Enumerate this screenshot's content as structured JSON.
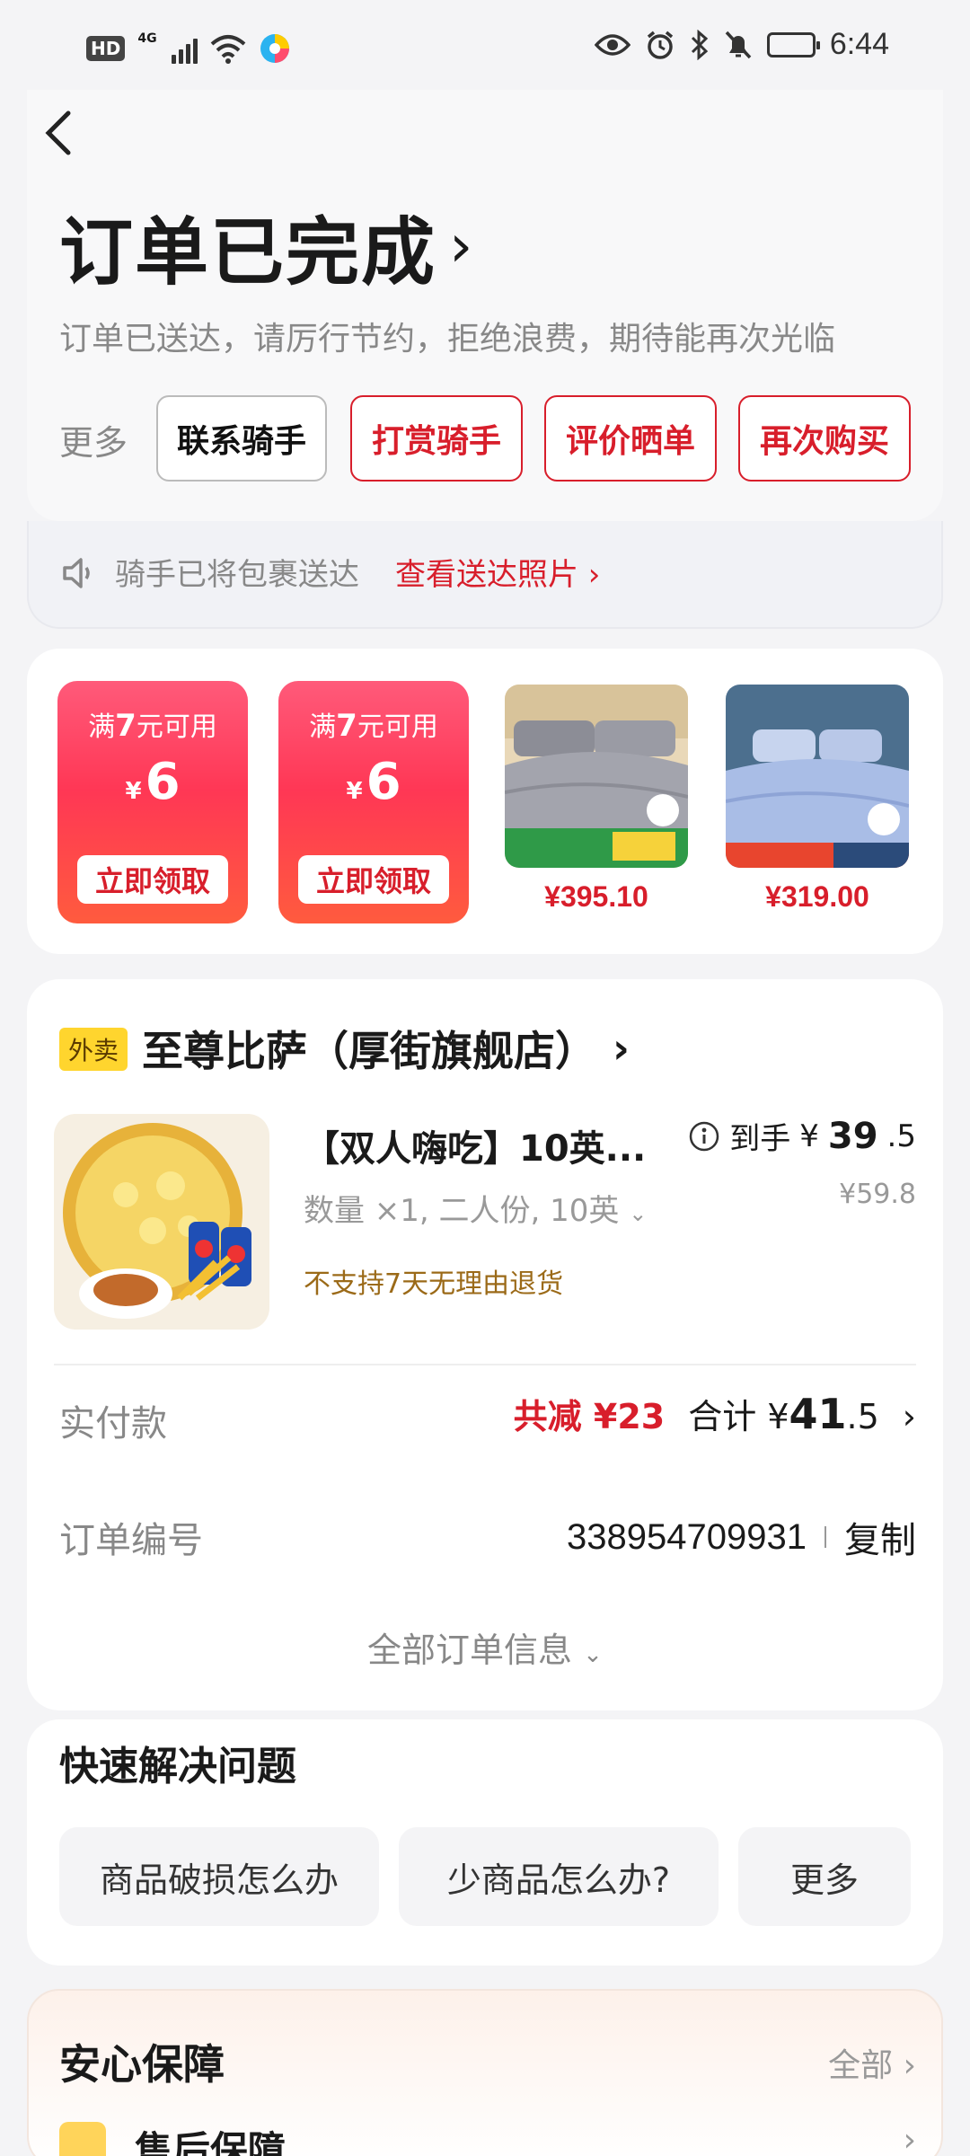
{
  "status_bar": {
    "hd": "HD",
    "network": "4G",
    "time": "6:44"
  },
  "header": {
    "title": "订单已完成",
    "subtitle": "订单已送达，请厉行节约，拒绝浪费，期待能再次光临"
  },
  "actions": {
    "more_label": "更多",
    "buttons": [
      "联系骑手",
      "打赏骑手",
      "评价晒单",
      "再次购买"
    ]
  },
  "notice": {
    "text": "骑手已将包裹送达",
    "link": "查看送达照片 ›"
  },
  "coupons": [
    {
      "cond_prefix": "满",
      "cond_num": "7",
      "cond_suffix": "元可用",
      "currency": "¥",
      "amount": "6",
      "button": "立即领取"
    },
    {
      "cond_prefix": "满",
      "cond_num": "7",
      "cond_suffix": "元可用",
      "currency": "¥",
      "amount": "6",
      "button": "立即领取"
    }
  ],
  "products": [
    {
      "price": "¥395.10",
      "image": "gray-bedding"
    },
    {
      "price": "¥319.00",
      "image": "blue-bedding"
    }
  ],
  "order": {
    "tag": "外卖",
    "shop": "至尊比萨（厚街旗舰店）",
    "item": {
      "name": "【双人嗨吃】10英...",
      "spec": "数量 ×1, 二人份, 10英",
      "note": "不支持7天无理由退货",
      "price_label": "到手",
      "price_currency": "¥",
      "price_int": "39",
      "price_dec": ".5",
      "orig_price": "¥59.8"
    },
    "paid_label": "实付款",
    "saved": "共减 ¥23",
    "total_label": "合计",
    "total_currency": "¥",
    "total_int": "41",
    "total_dec": ".5",
    "order_no_label": "订单编号",
    "order_no": "338954709931",
    "copy": "复制",
    "all_info": "全部订单信息"
  },
  "quick": {
    "title": "快速解决问题",
    "buttons": [
      "商品破损怎么办",
      "少商品怎么办?",
      "更多"
    ]
  },
  "guarantee": {
    "title": "安心保障",
    "all": "全部",
    "sub": "售后保障"
  }
}
